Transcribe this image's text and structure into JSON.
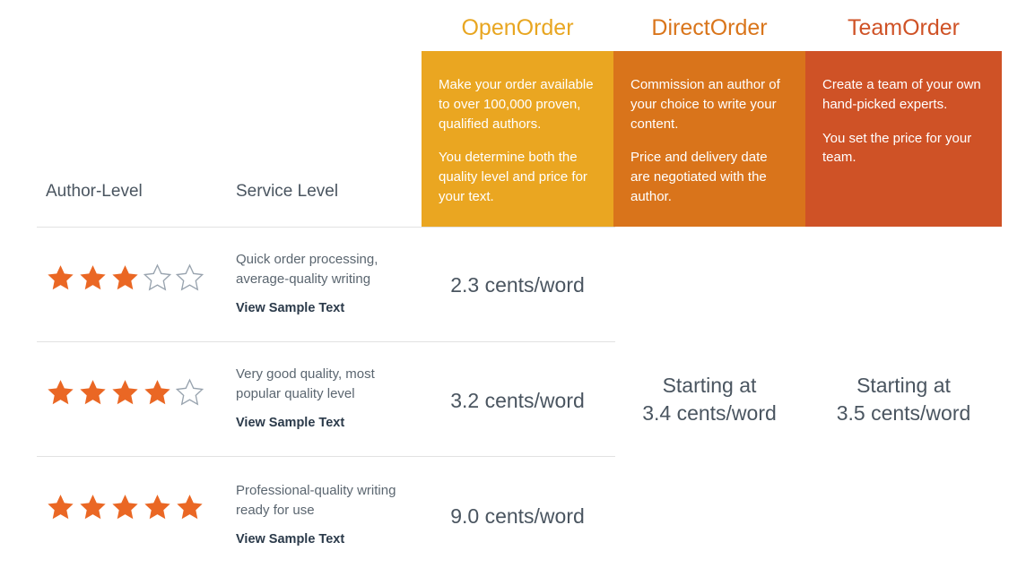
{
  "plans": [
    {
      "id": "open-order",
      "name": "OpenOrder",
      "header_color": "#e8a621",
      "box_color": "#eaa621",
      "description": [
        "Make your order available to over 100,000 proven, qualified authors.",
        "You determine both the quality level and price for your text."
      ]
    },
    {
      "id": "direct-order",
      "name": "DirectOrder",
      "header_color": "#d9751b",
      "box_color": "#d9741b",
      "description": [
        "Commission an author of your choice to write your content.",
        "Price and delivery date are negotiated with the author."
      ]
    },
    {
      "id": "team-order",
      "name": "TeamOrder",
      "header_color": "#cf5226",
      "box_color": "#cf5226",
      "description": [
        "Create a team of your own hand-picked experts.",
        "You set the price for your team."
      ]
    }
  ],
  "columns": {
    "author_level": "Author-Level",
    "service_level": "Service Level"
  },
  "colors": {
    "star_filled": "#ea6724",
    "star_empty_outline": "#98a3ae",
    "text": "#4a5560",
    "link": "#2b3a4a",
    "rule": "#e2e2e2"
  },
  "icons": {
    "star_filled": "star-filled-icon",
    "star_empty": "star-empty-icon"
  },
  "rows": [
    {
      "rating": 3,
      "max_rating": 5,
      "service_description": "Quick order processing, average-quality writing",
      "sample_link": "View Sample Text",
      "open_order_price": "2.3 cents/word"
    },
    {
      "rating": 4,
      "max_rating": 5,
      "service_description": "Very good quality, most popular quality level",
      "sample_link": "View Sample Text",
      "open_order_price": "3.2 cents/word"
    },
    {
      "rating": 5,
      "max_rating": 5,
      "service_description": "Professional-quality writing ready for use",
      "sample_link": "View Sample Text",
      "open_order_price": "9.0 cents/word"
    }
  ],
  "direct_order_price": {
    "prefix": "Starting at",
    "value": "3.4 cents/word"
  },
  "team_order_price": {
    "prefix": "Starting at",
    "value": "3.5 cents/word"
  }
}
